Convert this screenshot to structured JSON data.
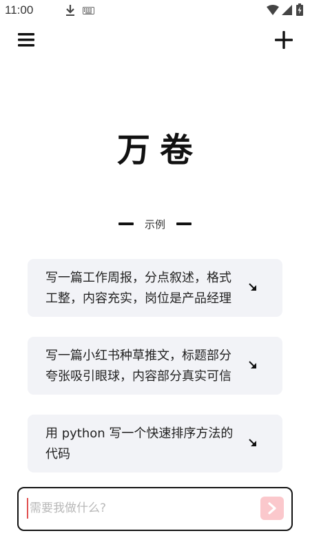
{
  "status_bar": {
    "time": "11:00",
    "icons": [
      "download-icon",
      "keyboard-icon",
      "wifi-icon",
      "signal-icon",
      "battery-icon"
    ]
  },
  "header": {
    "menu_icon": "hamburger-menu-icon",
    "new_icon": "plus-icon"
  },
  "logo": "万卷",
  "examples": {
    "label": "示例",
    "items": [
      {
        "text": "写一篇工作周报，分点叙述，格式工整，内容充实，岗位是产品经理",
        "icon": "arrow-down-right-icon"
      },
      {
        "text": "写一篇小红书种草推文，标题部分夸张吸引眼球，内容部分真实可信",
        "icon": "arrow-down-right-icon"
      },
      {
        "text": "用 python 写一个快速排序方法的代码",
        "icon": "arrow-down-right-icon"
      }
    ]
  },
  "input": {
    "placeholder": "需要我做什么?",
    "value": ""
  },
  "send_button": {
    "icon": "chevron-right-icon",
    "color": "#fbc8cc"
  }
}
